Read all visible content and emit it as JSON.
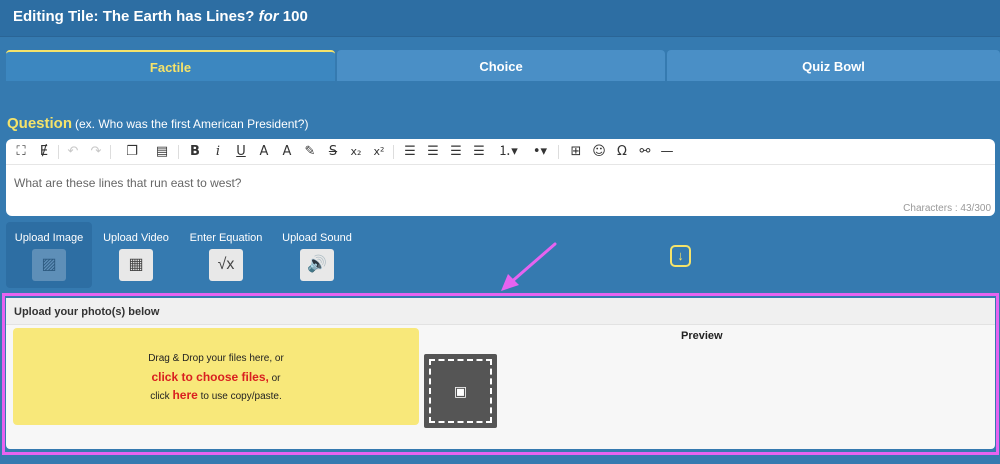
{
  "header": {
    "title_prefix": "Editing Tile: The Earth has Lines?",
    "title_for": "for",
    "title_points": "100"
  },
  "tabs": [
    {
      "label": "Factile",
      "active": true
    },
    {
      "label": "Choice",
      "active": false
    },
    {
      "label": "Quiz Bowl",
      "active": false
    }
  ],
  "question": {
    "label": "Question",
    "hint": "(ex. Who was the first American President?)",
    "text": "What are these lines that run east to west?",
    "char_count": "Characters : 43/300"
  },
  "toolbar": {
    "icons": [
      "fullscreen-icon",
      "clear-format-icon",
      "undo-icon",
      "redo-icon",
      "copy-icon",
      "paste-icon",
      "bold-icon",
      "italic-icon",
      "underline-icon",
      "text-color-icon",
      "highlight-icon",
      "marker-icon",
      "strikethrough-icon",
      "subscript-icon",
      "superscript-icon",
      "align-left-icon",
      "align-center-icon",
      "align-right-icon",
      "justify-icon",
      "ordered-list-icon",
      "unordered-list-icon",
      "table-icon",
      "emoji-icon",
      "special-char-icon",
      "link-icon",
      "horizontal-rule-icon"
    ]
  },
  "upload_options": [
    {
      "label": "Upload Image",
      "icon": "image-icon",
      "active": true
    },
    {
      "label": "Upload Video",
      "icon": "video-icon",
      "active": false
    },
    {
      "label": "Enter Equation",
      "icon": "sqrt-icon",
      "active": false
    },
    {
      "label": "Upload Sound",
      "icon": "speaker-icon",
      "active": false
    }
  ],
  "upload_panel": {
    "title": "Upload your photo(s) below",
    "drop_line1": "Drag & Drop your files here, or",
    "drop_link": "click to choose files,",
    "drop_or": "or",
    "drop_click": "click",
    "drop_here": "here",
    "drop_tail": "to use copy/paste.",
    "preview_label": "Preview"
  },
  "colors": {
    "background": "#357ab0",
    "accent_yellow": "#f5e36a",
    "highlight_magenta": "#e663f0",
    "drop_zone": "#f8e87a",
    "link_red": "#d92020"
  }
}
